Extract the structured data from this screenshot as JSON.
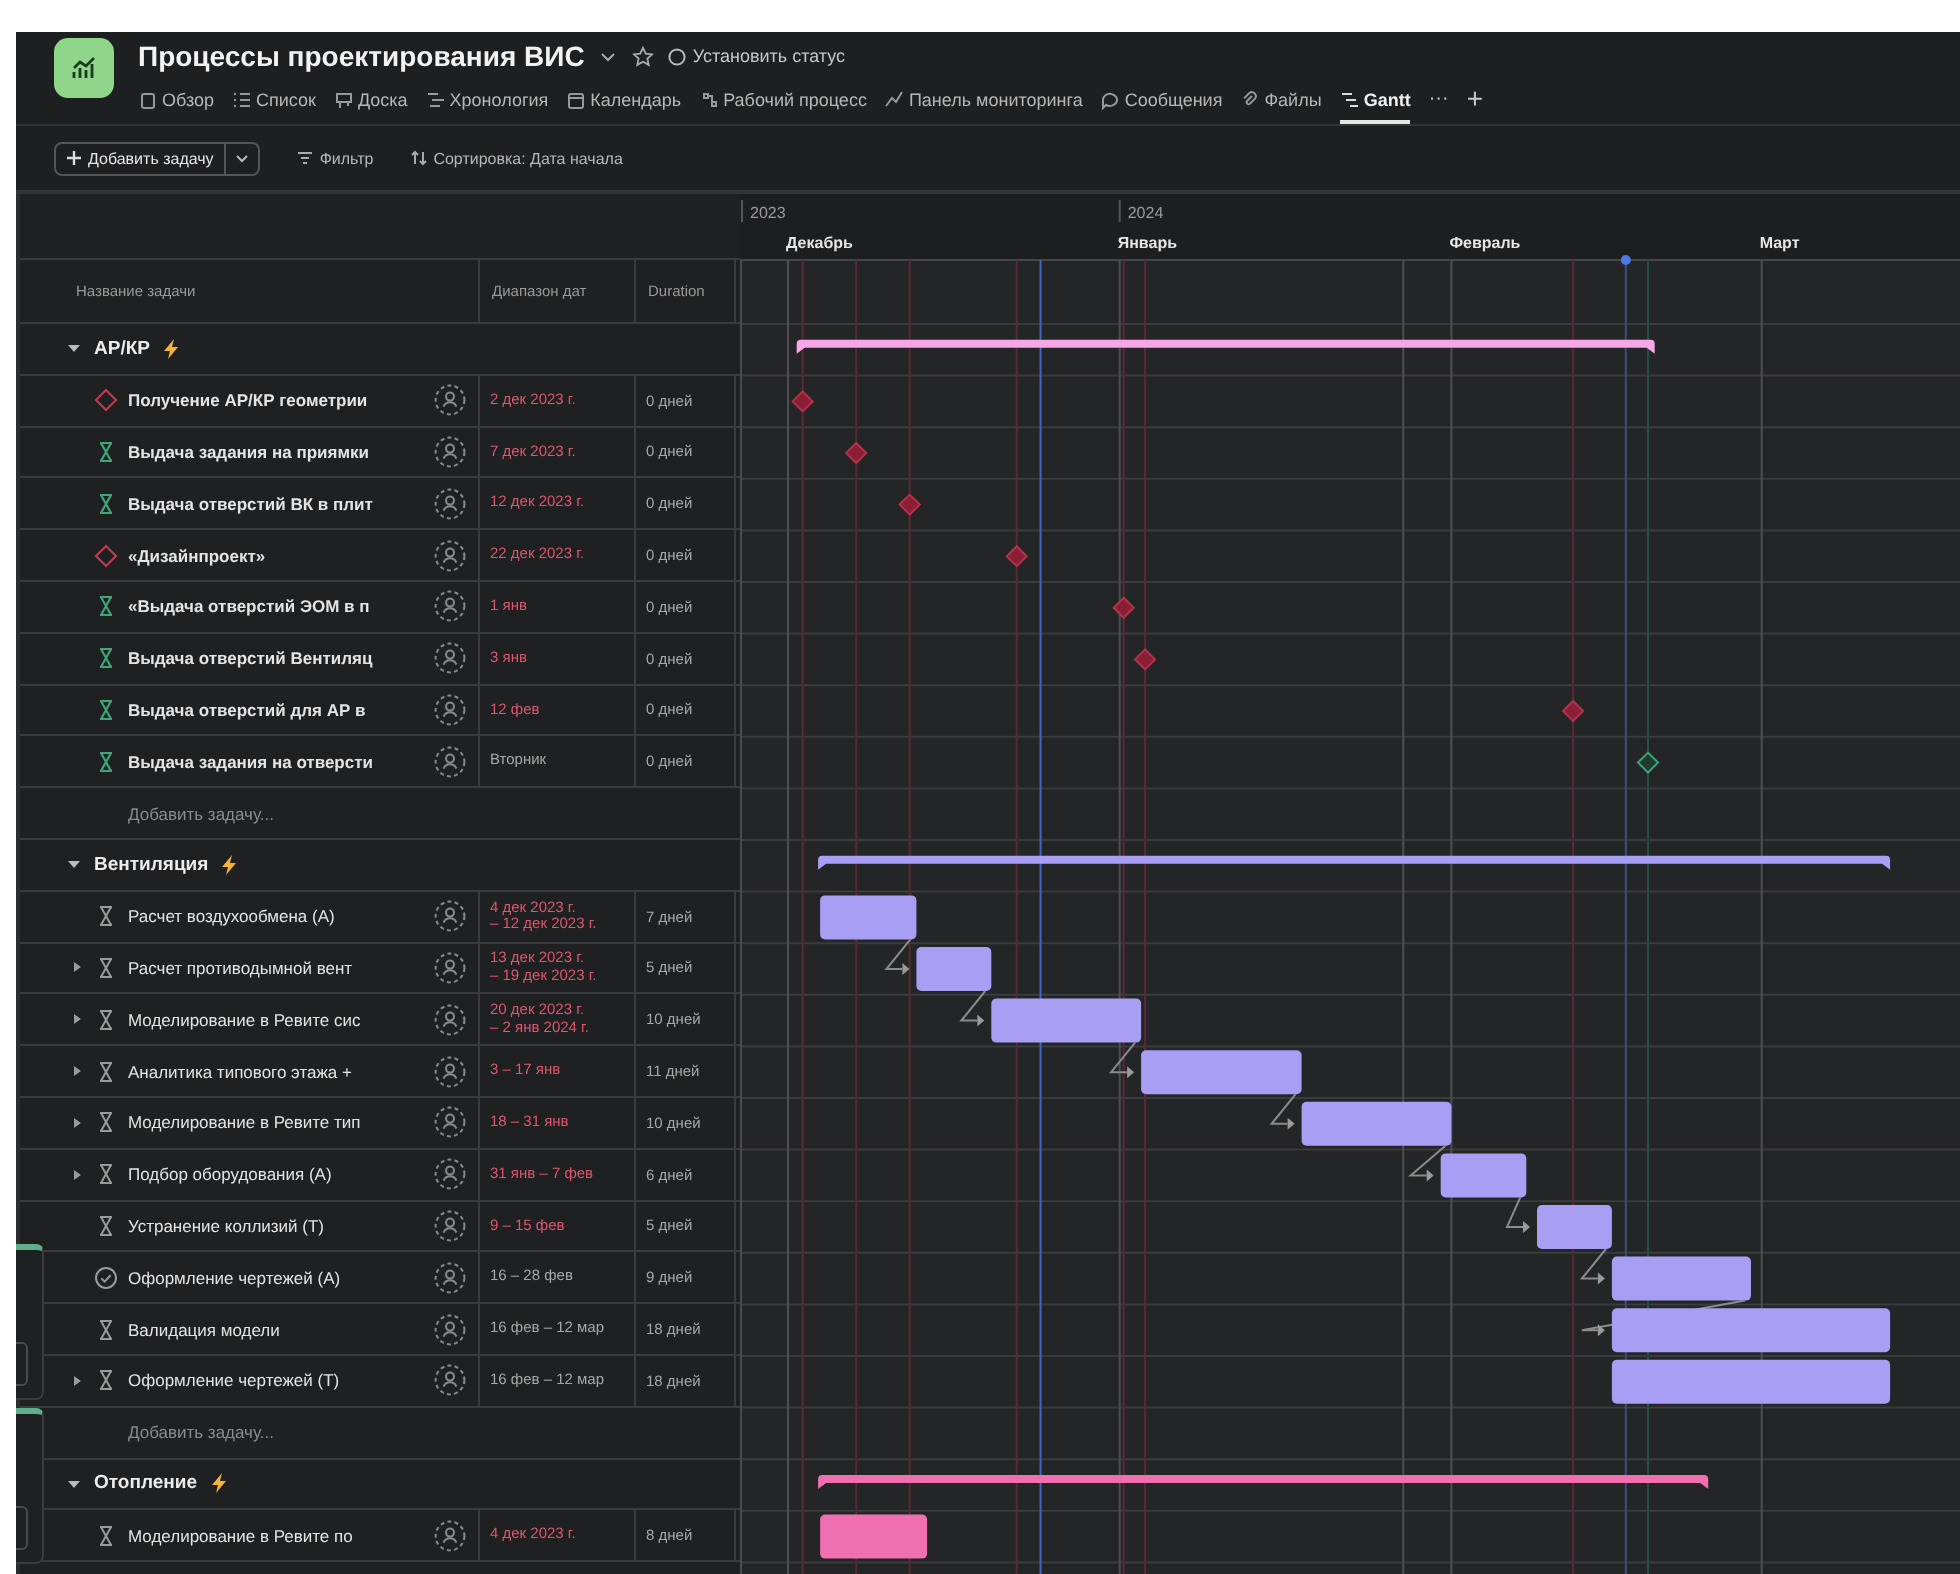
{
  "project": {
    "title": "Процессы проектирования ВИС",
    "status": "Установить статус"
  },
  "tabs": [
    {
      "label": "Обзор",
      "selected": false
    },
    {
      "label": "Список",
      "selected": false
    },
    {
      "label": "Доска",
      "selected": false
    },
    {
      "label": "Хронология",
      "selected": false
    },
    {
      "label": "Календарь",
      "selected": false
    },
    {
      "label": "Рабочий процесс",
      "selected": false
    },
    {
      "label": "Панель мониторинга",
      "selected": false
    },
    {
      "label": "Сообщения",
      "selected": false
    },
    {
      "label": "Файлы",
      "selected": false
    },
    {
      "label": "Gantt",
      "selected": true
    }
  ],
  "tab_more": "···",
  "tab_add": "+",
  "toolbar": {
    "add_task": "Добавить задачу",
    "filter": "Фильтр",
    "sort": "Сортировка: Дата начала"
  },
  "columns": [
    "Название задачи",
    "Диапазон дат",
    "Duration"
  ],
  "timeline": {
    "years": [
      "2023",
      "2024"
    ],
    "months": [
      "Декабрь",
      "Январь",
      "Февраль",
      "Март"
    ]
  },
  "groups": [
    {
      "name": "АР/КР",
      "color": "#f7a6e6",
      "add_label": "Добавить задачу...",
      "tasks": [
        {
          "name": "Получение АР/КР геометрии",
          "kind": "approval",
          "has_subtasks": false,
          "date": "2 дек 2023 г.",
          "overdue": true,
          "duration": "0 дней"
        },
        {
          "name": "Выдача задания на приямки",
          "kind": "milestone",
          "has_subtasks": false,
          "date": "7 дек 2023 г.",
          "overdue": true,
          "duration": "0 дней"
        },
        {
          "name": "Выдача отверстий ВК в плит",
          "kind": "milestone",
          "has_subtasks": false,
          "date": "12 дек 2023 г.",
          "overdue": true,
          "duration": "0 дней"
        },
        {
          "name": "«Дизайнпроект»",
          "kind": "approval",
          "has_subtasks": false,
          "date": "22 дек 2023 г.",
          "overdue": true,
          "duration": "0 дней"
        },
        {
          "name": "«Выдача отверстий ЭОМ в п",
          "kind": "milestone",
          "has_subtasks": false,
          "date": "1 янв",
          "overdue": true,
          "duration": "0 дней"
        },
        {
          "name": "Выдача отверстий Вентиляц",
          "kind": "milestone",
          "has_subtasks": false,
          "date": "3 янв",
          "overdue": true,
          "duration": "0 дней"
        },
        {
          "name": "Выдача отверстий для АР в",
          "kind": "milestone",
          "has_subtasks": false,
          "date": "12 фев",
          "overdue": true,
          "duration": "0 дней"
        },
        {
          "name": "Выдача задания на отверсти",
          "kind": "milestone",
          "has_subtasks": false,
          "date": "Вторник",
          "overdue": false,
          "duration": "0 дней"
        }
      ]
    },
    {
      "name": "Вентиляция",
      "color": "#a89ff5",
      "add_label": "Добавить задачу...",
      "tasks": [
        {
          "name": "Расчет воздухообмена (А)",
          "kind": "task",
          "has_subtasks": false,
          "date": "4 дек 2023 г.\n– 12 дек 2023 г.",
          "overdue": true,
          "duration": "7 дней"
        },
        {
          "name": "Расчет противодымной вент",
          "kind": "task",
          "has_subtasks": true,
          "date": "13 дек 2023 г.\n– 19 дек 2023 г.",
          "overdue": true,
          "duration": "5 дней"
        },
        {
          "name": "Моделирование в Ревите сис",
          "kind": "task",
          "has_subtasks": true,
          "date": "20 дек 2023 г.\n– 2 янв 2024 г.",
          "overdue": true,
          "duration": "10 дней"
        },
        {
          "name": "Аналитика типового этажа +",
          "kind": "task",
          "has_subtasks": true,
          "date": "3 – 17 янв",
          "overdue": true,
          "duration": "11 дней"
        },
        {
          "name": "Моделирование в Ревите тип",
          "kind": "task",
          "has_subtasks": true,
          "date": "18 – 31 янв",
          "overdue": true,
          "duration": "10 дней"
        },
        {
          "name": "Подбор оборудования (А)",
          "kind": "task",
          "has_subtasks": true,
          "date": "31 янв – 7 фев",
          "overdue": true,
          "duration": "6 дней"
        },
        {
          "name": "Устранение коллизий (Т)",
          "kind": "task",
          "has_subtasks": false,
          "date": "9 – 15 фев",
          "overdue": true,
          "duration": "5 дней"
        },
        {
          "name": "Оформление чертежей (А)",
          "kind": "done",
          "has_subtasks": false,
          "date": "16 – 28 фев",
          "overdue": false,
          "duration": "9 дней"
        },
        {
          "name": "Валидация модели",
          "kind": "task",
          "has_subtasks": false,
          "date": "16 фев – 12 мар",
          "overdue": false,
          "duration": "18 дней"
        },
        {
          "name": "Оформление чертежей (Т)",
          "kind": "task",
          "has_subtasks": true,
          "date": "16 фев – 12 мар",
          "overdue": false,
          "duration": "18 дней"
        }
      ]
    },
    {
      "name": "Отопление",
      "color": "#f06fb0",
      "tasks": [
        {
          "name": "Моделирование в Ревите по",
          "kind": "task",
          "has_subtasks": false,
          "date": "4 дек 2023 г.",
          "overdue": true,
          "duration": "8 дней"
        }
      ]
    }
  ]
}
